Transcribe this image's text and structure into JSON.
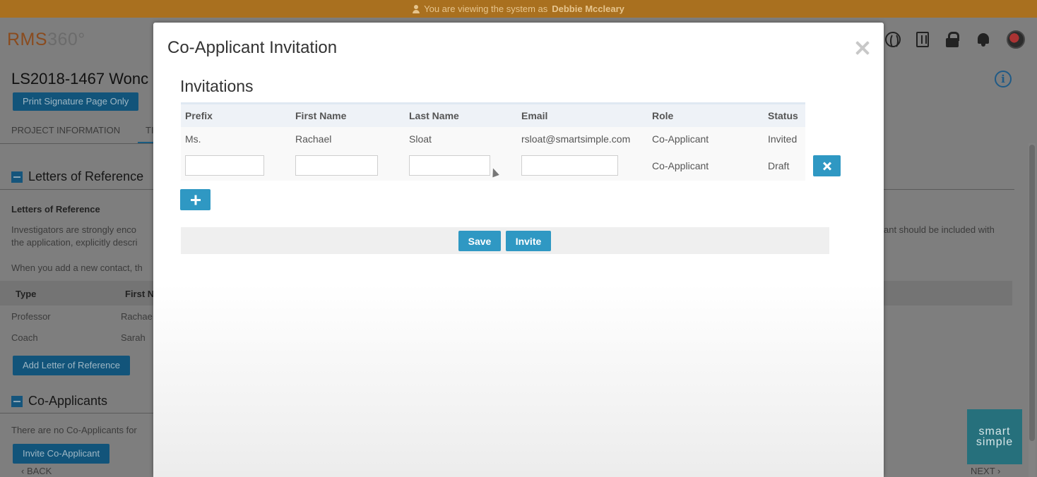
{
  "banner": {
    "prefix": "You are viewing the system as",
    "user": "Debbie Mccleary"
  },
  "header": {
    "logo_a": "RMS",
    "logo_b": "360°",
    "icons": [
      "globe-icon",
      "building-icon",
      "lock-icon",
      "bell-icon",
      "avatar"
    ]
  },
  "page": {
    "title": "LS2018-1467 Wonc",
    "print_button": "Print Signature Page Only",
    "tabs": [
      "PROJECT INFORMATION",
      "TI"
    ],
    "letters": {
      "heading": "Letters of Reference",
      "label": "Letters of Reference",
      "para1_line1": "Investigators are strongly enco",
      "para1_line2": "the application, explicitly descri",
      "para1_right": "ant should be included with",
      "para2": "When you add a new contact, th",
      "col_type": "Type",
      "col_first": "First N",
      "rows": [
        {
          "type": "Professor",
          "first": "Rachae"
        },
        {
          "type": "Coach",
          "first": "Sarah"
        }
      ],
      "add_button": "Add Letter of Reference"
    },
    "coapplicants": {
      "heading": "Co-Applicants",
      "text": "There are no Co-Applicants for",
      "invite_button": "Invite Co-Applicant"
    },
    "back": "BACK",
    "next": "NEXT"
  },
  "modal": {
    "title": "Co-Applicant Invitation",
    "subtitle": "Invitations",
    "columns": [
      "Prefix",
      "First Name",
      "Last Name",
      "Email",
      "Role",
      "Status"
    ],
    "rows": [
      {
        "prefix": "Ms.",
        "first": "Rachael",
        "last": "Sloat",
        "email": "rsloat@smartsimple.com",
        "role": "Co-Applicant",
        "status": "Invited"
      }
    ],
    "new_row": {
      "prefix": "",
      "first": "",
      "last": "",
      "email": "",
      "role": "Co-Applicant",
      "status": "Draft"
    },
    "save_label": "Save",
    "invite_label": "Invite"
  },
  "watermark": {
    "line1": "smart",
    "line2": "simple"
  }
}
